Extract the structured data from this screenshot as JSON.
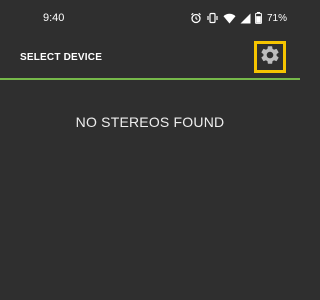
{
  "status_bar": {
    "time": "9:40",
    "battery_percent": "71%",
    "icons": [
      "alarm-icon",
      "vibrate-icon",
      "wifi-icon",
      "signal-icon",
      "battery-icon"
    ]
  },
  "toolbar": {
    "title": "SELECT DEVICE",
    "settings_icon": "gear-icon",
    "accent_color": "#76b84a",
    "highlight_color": "#f5c400"
  },
  "main": {
    "empty_message": "NO STEREOS FOUND"
  }
}
